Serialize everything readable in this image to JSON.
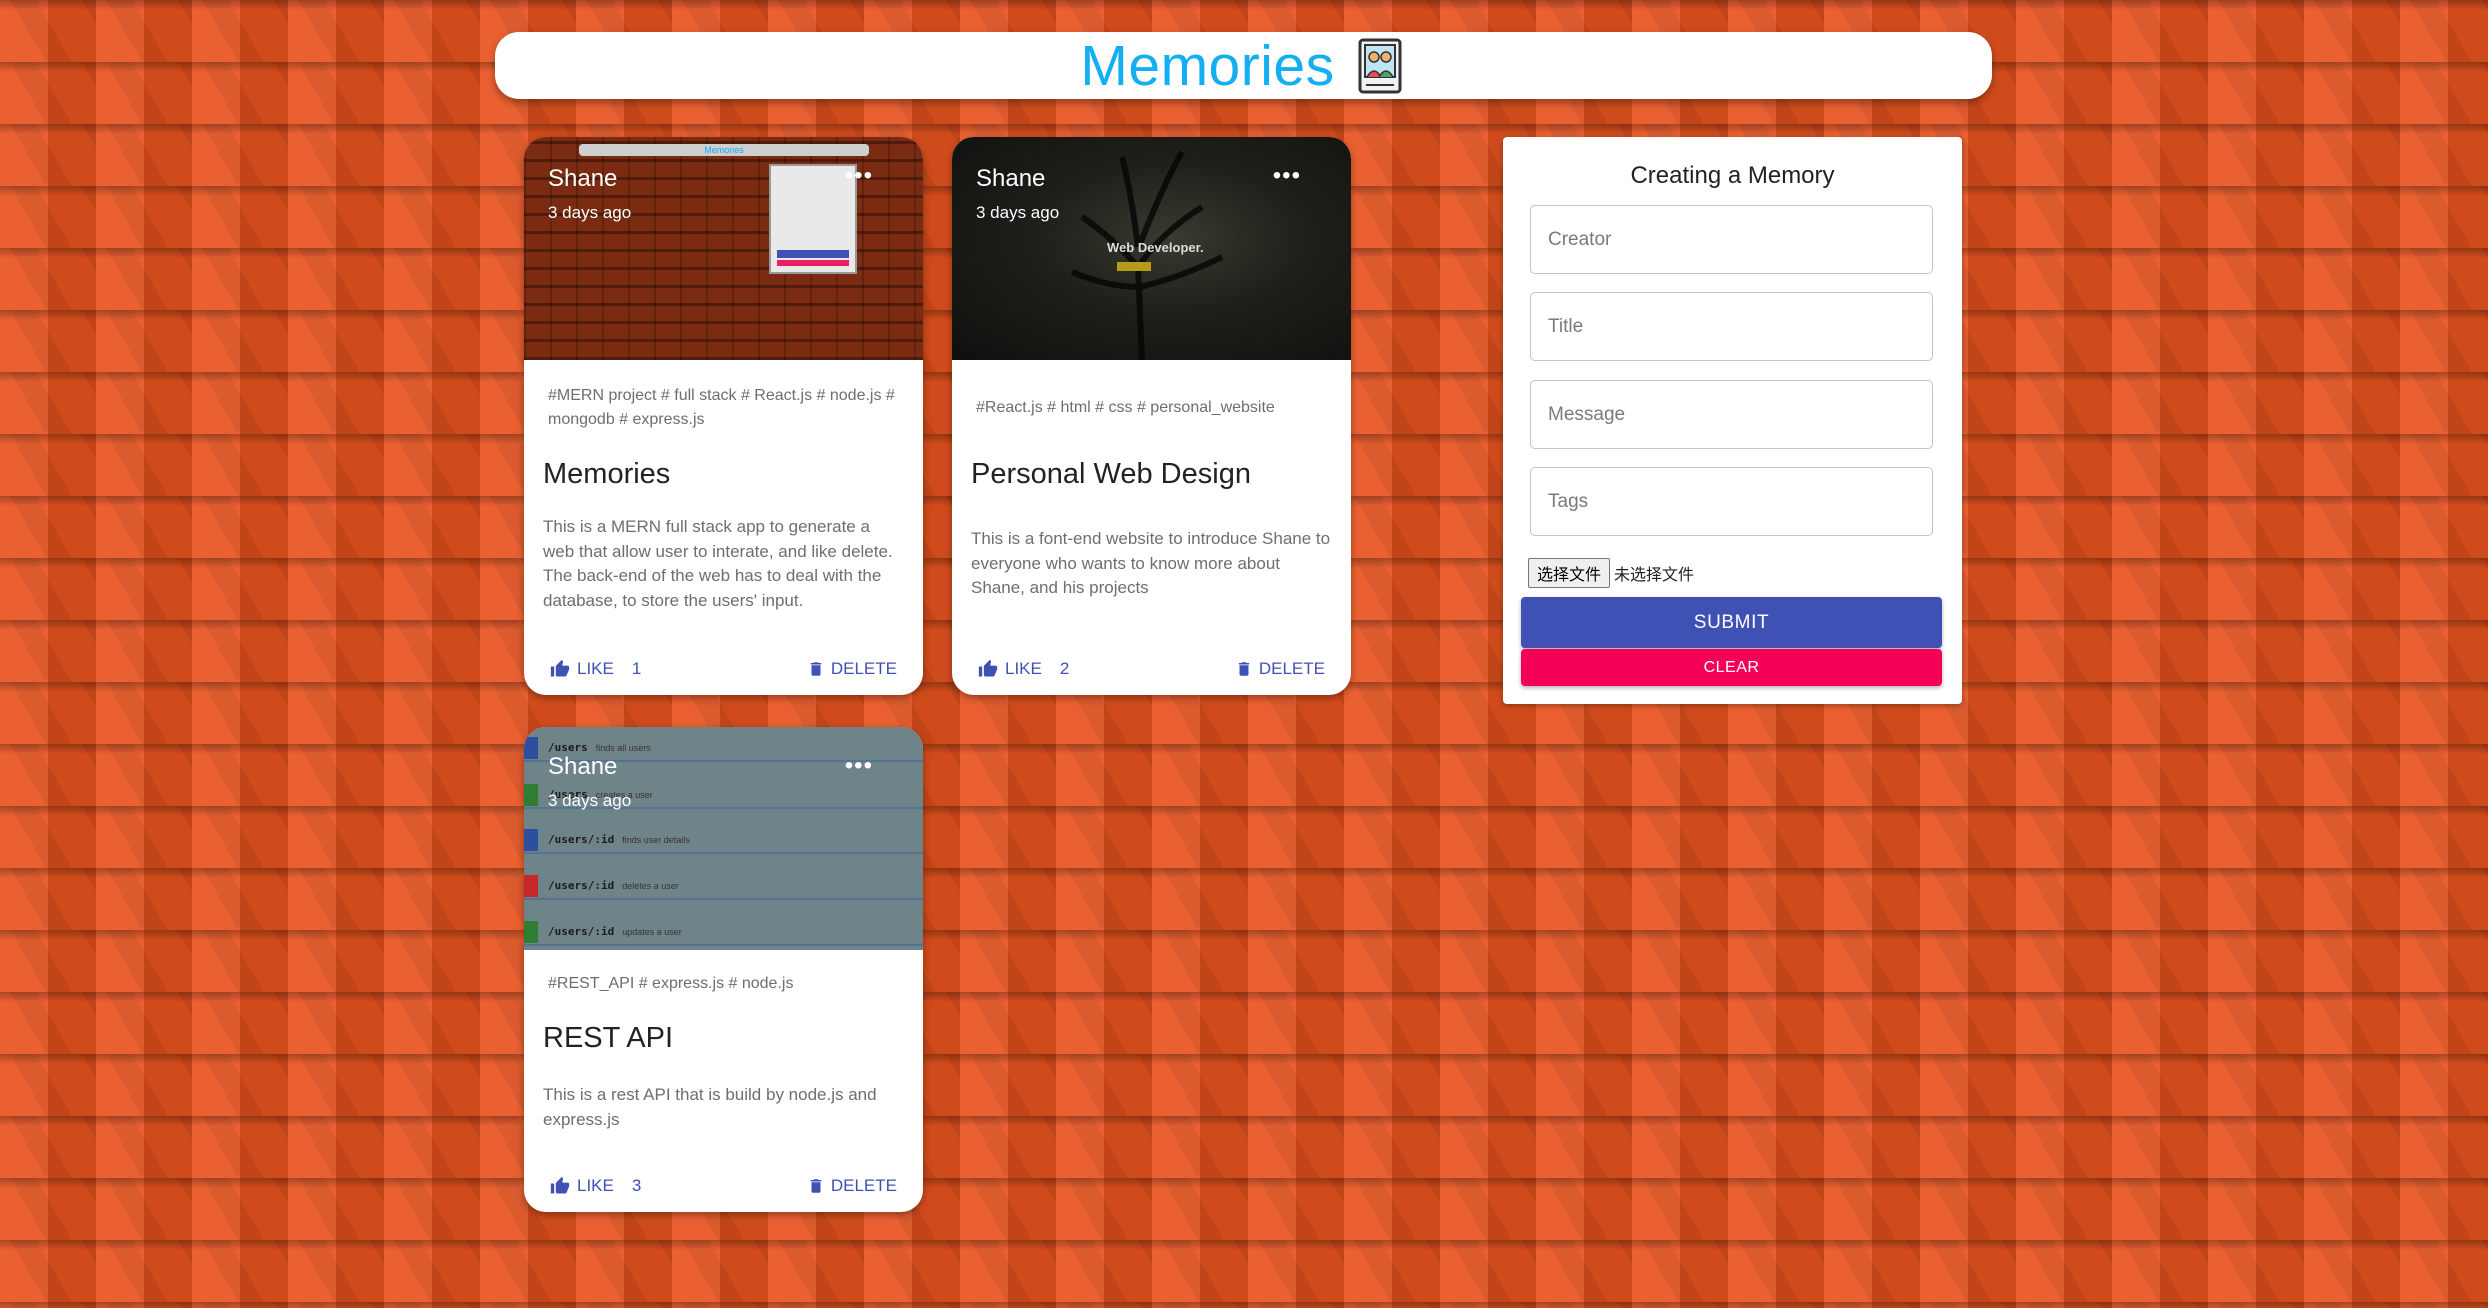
{
  "header": {
    "title": "Memories",
    "logo_icon": "memories-photo-icon"
  },
  "colors": {
    "title": "#14aef2",
    "primary": "#3f51b5",
    "secondary": "#f50057",
    "background": "#e8531f"
  },
  "posts": [
    {
      "creator": "Shane",
      "time": "3 days ago",
      "tags": "#MERN project # full stack # React.js # node.js # mongodb # express.js",
      "title": "Memories",
      "message": "This is a MERN full stack app to generate a web that allow user to interate, and like delete. The back-end of the web has to deal with the database, to store the users' input.",
      "like_label": "LIKE",
      "like_count": "1",
      "delete_label": "DELETE",
      "media_caption": "Memories"
    },
    {
      "creator": "Shane",
      "time": "3 days ago",
      "tags": "#React.js # html # css # personal_website",
      "title": "Personal Web Design",
      "message": "This is a font-end website to introduce Shane to everyone who wants to know more about Shane, and his projects",
      "like_label": "LIKE",
      "like_count": "2",
      "delete_label": "DELETE",
      "media_caption": "Web Developer."
    },
    {
      "creator": "Shane",
      "time": "3 days ago",
      "tags": "#REST_API # express.js # node.js",
      "title": "REST API",
      "message": "This is a rest API that is build by node.js and express.js",
      "like_label": "LIKE",
      "like_count": "3",
      "delete_label": "DELETE",
      "media_rows": [
        {
          "path": "/users",
          "desc": "finds all users",
          "color": "#2c4f9e"
        },
        {
          "path": "/users",
          "desc": "creates a user",
          "color": "#2e7d32"
        },
        {
          "path": "/users/:id",
          "desc": "finds user details",
          "color": "#2c4f9e"
        },
        {
          "path": "/users/:id",
          "desc": "deletes a user",
          "color": "#c62828"
        },
        {
          "path": "/users/:id",
          "desc": "updates a user",
          "color": "#2e7d32"
        }
      ]
    }
  ],
  "form": {
    "title": "Creating a Memory",
    "creator_placeholder": "Creator",
    "title_placeholder": "Title",
    "message_placeholder": "Message",
    "tags_placeholder": "Tags",
    "file_button": "选择文件",
    "file_status": "未选择文件",
    "submit_label": "SUBMIT",
    "clear_label": "CLEAR"
  }
}
